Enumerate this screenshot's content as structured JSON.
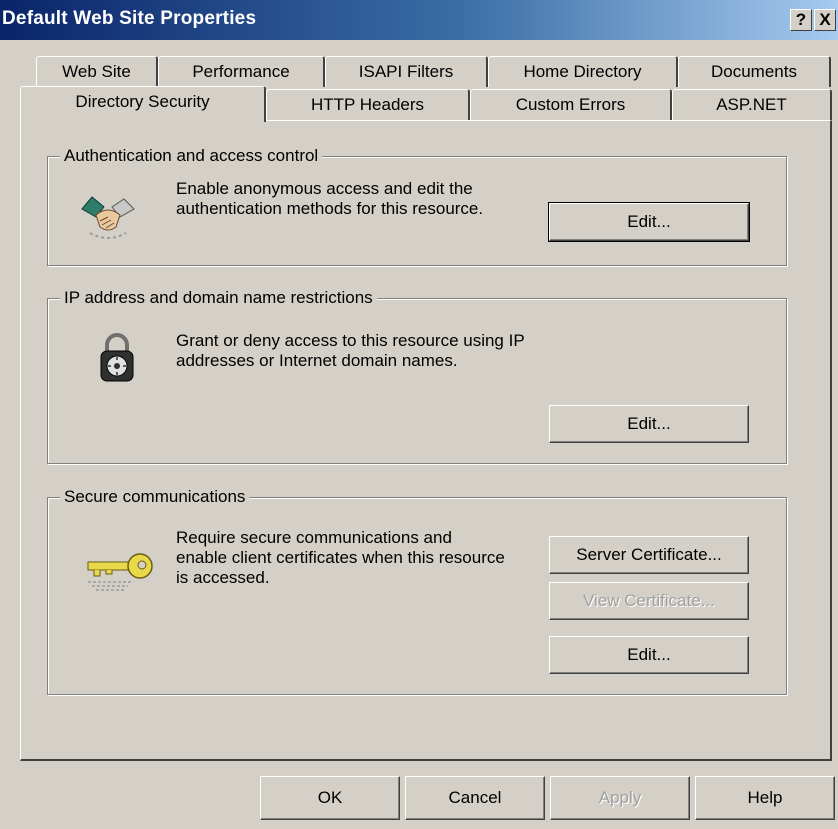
{
  "window": {
    "title": "Default Web Site Properties",
    "help_glyph": "?",
    "close_glyph": "X"
  },
  "tabs": {
    "row1": [
      "Web Site",
      "Performance",
      "ISAPI Filters",
      "Home Directory",
      "Documents"
    ],
    "row2": [
      "Directory Security",
      "HTTP Headers",
      "Custom Errors",
      "ASP.NET"
    ],
    "selected": "Directory Security"
  },
  "auth": {
    "legend": "Authentication and access control",
    "description": "Enable anonymous access and edit the authentication methods for this resource.",
    "edit_label": "Edit...",
    "icon": "handshake-icon"
  },
  "ip": {
    "legend": "IP address and domain name restrictions",
    "description": "Grant or deny access to this resource using IP addresses or Internet domain names.",
    "edit_label": "Edit...",
    "icon": "padlock-icon"
  },
  "secure": {
    "legend": "Secure communications",
    "description": "Require secure communications and enable client certificates when this resource is accessed.",
    "server_cert_label": "Server Certificate...",
    "view_cert_label": "View Certificate...",
    "edit_label": "Edit...",
    "icon": "key-icon"
  },
  "buttons": {
    "ok": "OK",
    "cancel": "Cancel",
    "apply": "Apply",
    "help": "Help"
  }
}
